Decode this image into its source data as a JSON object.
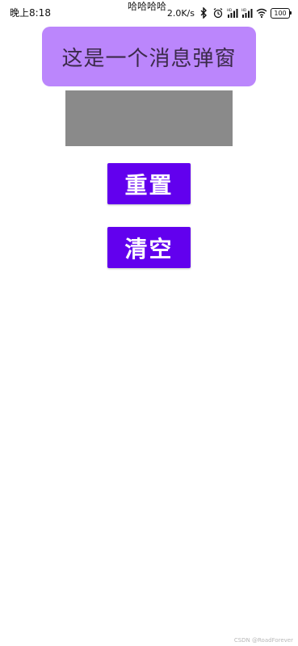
{
  "status_bar": {
    "time": "晚上8:18",
    "network_speed": "2.0K/s",
    "battery": "100",
    "icons": [
      "bluetooth-icon",
      "alarm-icon",
      "signal-hd-icon",
      "signal-hd-icon",
      "wifi-icon",
      "battery-icon"
    ]
  },
  "overlay_text": "哈哈哈哈",
  "toast": {
    "text": "这是一个消息弹窗",
    "color": "#bb86fc"
  },
  "buttons": {
    "reset_label": "重置",
    "clear_label": "清空",
    "color": "#6200ee"
  },
  "watermark": "CSDN @RoadForever"
}
